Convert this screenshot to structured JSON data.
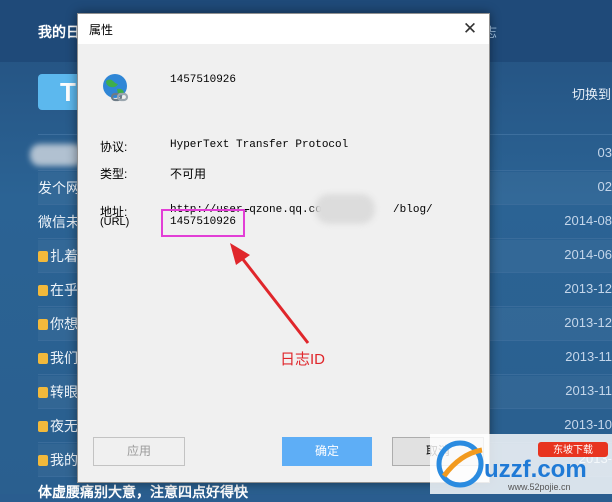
{
  "background": {
    "page_title": "我的日志",
    "tab_right_fragment": "志",
    "logo_letter": "T",
    "switch_label": "切换到",
    "rows": [
      {
        "title": "",
        "date": "03",
        "locked": false
      },
      {
        "title": "发个网",
        "date": "02",
        "locked": false
      },
      {
        "title": "微信未",
        "date": "2014-08",
        "locked": false
      },
      {
        "title": "扎着",
        "date": "2014-06",
        "locked": true
      },
      {
        "title": "在乎",
        "date": "2013-12",
        "locked": true
      },
      {
        "title": "你想",
        "date": "2013-12",
        "locked": true
      },
      {
        "title": "我们",
        "date": "2013-11",
        "locked": true
      },
      {
        "title": "转眼",
        "date": "2013-11",
        "locked": true
      },
      {
        "title": "夜无",
        "date": "2013-10",
        "locked": true
      },
      {
        "title": "我的",
        "date": "2013-",
        "locked": true
      }
    ],
    "bottom_text": "体虚腰痛别大意，注意四点好得快"
  },
  "dialog": {
    "title": "属性",
    "close_glyph": "✕",
    "header_id": "1457510926",
    "protocol_label": "协议:",
    "protocol_value": "HyperText Transfer Protocol",
    "type_label": "类型:",
    "type_value": "不可用",
    "address_label": "地址:",
    "url_label": "(URL)",
    "address_prefix": "http://user.",
    "address_domain": "qzone.qq.com/",
    "address_suffix": "/blog/",
    "address_id": "1457510926",
    "annotation": "日志ID",
    "apply_label": "应用",
    "ok_label": "确定",
    "cancel_label": "取消"
  },
  "watermark": {
    "brand": "uzzf.com",
    "badge": "东坡下载",
    "site": "www.52pojie.cn"
  },
  "colors": {
    "accent": "#5eaef6",
    "highlight": "#e23ed6",
    "annotation": "#e0262b"
  }
}
